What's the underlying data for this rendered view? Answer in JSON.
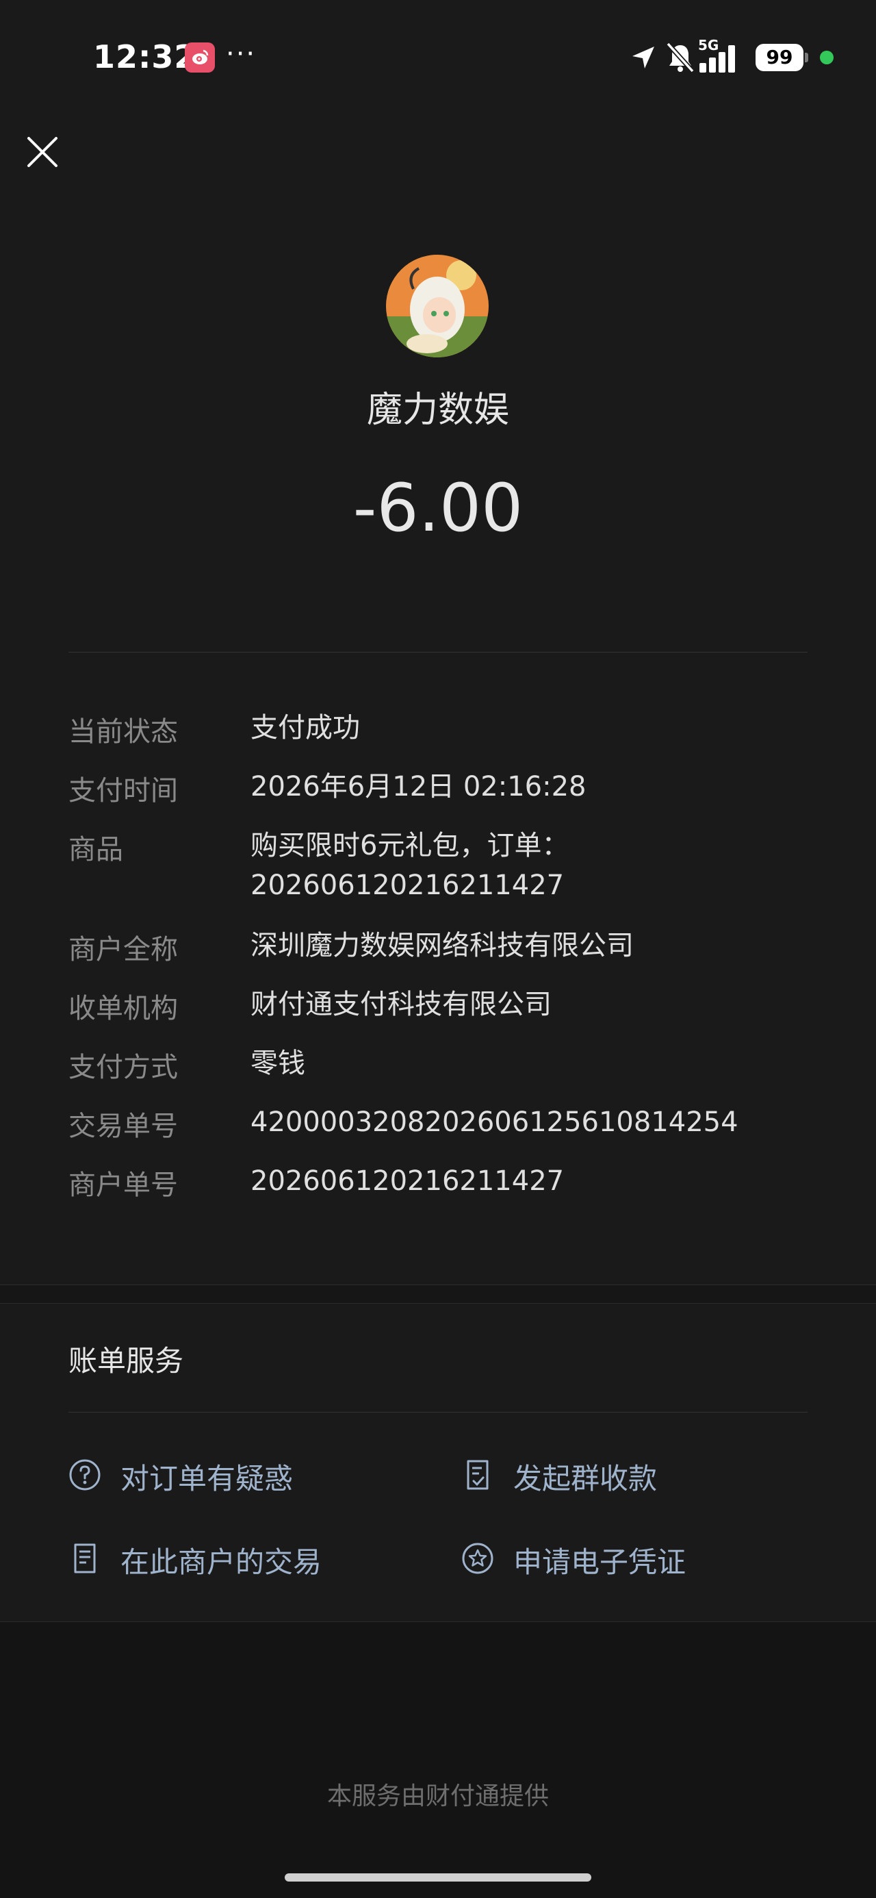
{
  "status_bar": {
    "time": "12:32",
    "more": "···",
    "network": "5G",
    "battery": "99",
    "icons": [
      "weibo-icon",
      "location-arrow-icon",
      "bell-muted-icon",
      "signal-bars-icon",
      "battery-icon"
    ],
    "dot_color": "#34c759"
  },
  "header": {
    "close_icon": "close-icon",
    "merchant_name": "魔力数娱",
    "amount": "-6.00"
  },
  "details": [
    {
      "label": "当前状态",
      "value": "支付成功"
    },
    {
      "label": "支付时间",
      "value": "2026年6月12日 02:16:28"
    },
    {
      "label": "商品",
      "value": "购买限时6元礼包，订单：",
      "value2": "202606120216211427"
    },
    {
      "label": "商户全称",
      "value": "深圳魔力数娱网络科技有限公司"
    },
    {
      "label": "收单机构",
      "value": "财付通支付科技有限公司"
    },
    {
      "label": "支付方式",
      "value": "零钱"
    },
    {
      "label": "交易单号",
      "value": "4200003208202606125610814254"
    },
    {
      "label": "商户单号",
      "value": "202606120216211427"
    }
  ],
  "services": {
    "title": "账单服务",
    "items": [
      {
        "label": "对订单有疑惑",
        "icon": "question-circle-icon"
      },
      {
        "label": "发起群收款",
        "icon": "document-check-icon"
      },
      {
        "label": "在此商户的交易",
        "icon": "receipt-icon"
      },
      {
        "label": "申请电子凭证",
        "icon": "star-badge-icon"
      }
    ],
    "link_color": "#9fb4cc"
  },
  "footer": "本服务由财付通提供"
}
